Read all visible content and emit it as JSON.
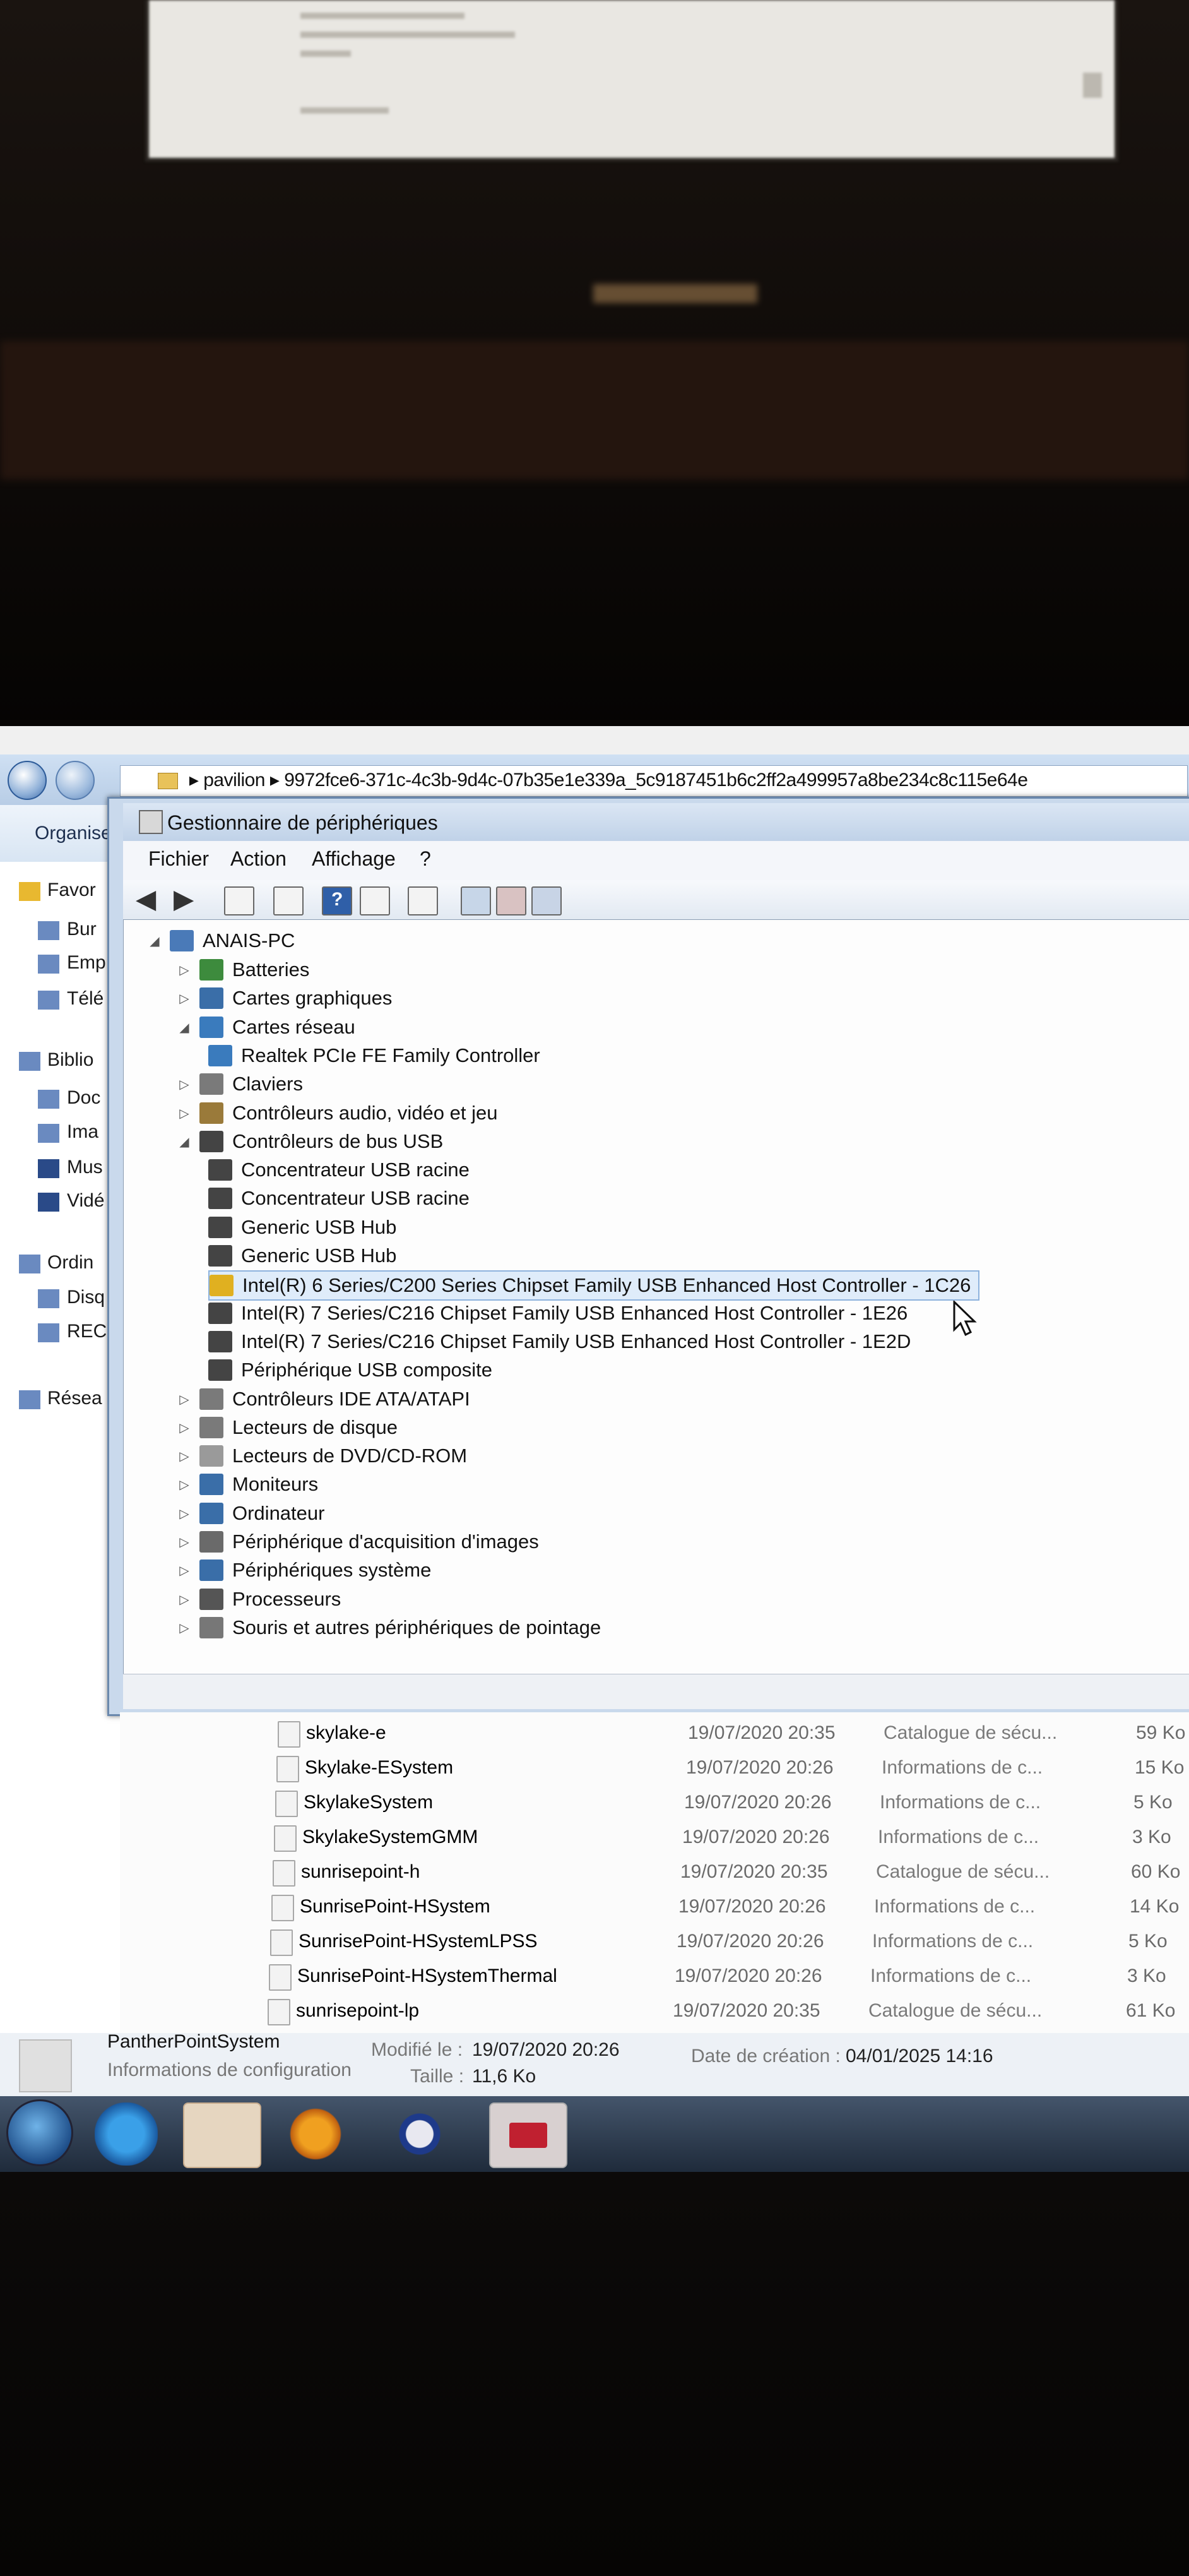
{
  "explorer": {
    "address_prefix": "pavilion",
    "address_path": "9972fce6-371c-4c3b-9d4c-07b35e1e339a_5c9187451b6c2ff2a499957a8be234c8c115e64e",
    "organise_label": "Organiser",
    "nav_items": [
      "Favor",
      "Bur",
      "Emp",
      "Télé",
      "Biblio",
      "Doc",
      "Ima",
      "Mus",
      "Vidé",
      "Ordin",
      "Disq",
      "REC",
      "Résea"
    ],
    "files": [
      {
        "name": "skylake-e",
        "date": "19/07/2020 20:35",
        "type": "Catalogue de sécu...",
        "size": "59 Ko"
      },
      {
        "name": "Skylake-ESystem",
        "date": "19/07/2020 20:26",
        "type": "Informations de c...",
        "size": "15 Ko"
      },
      {
        "name": "SkylakeSystem",
        "date": "19/07/2020 20:26",
        "type": "Informations de c...",
        "size": "5 Ko"
      },
      {
        "name": "SkylakeSystemGMM",
        "date": "19/07/2020 20:26",
        "type": "Informations de c...",
        "size": "3 Ko"
      },
      {
        "name": "sunrisepoint-h",
        "date": "19/07/2020 20:35",
        "type": "Catalogue de sécu...",
        "size": "60 Ko"
      },
      {
        "name": "SunrisePoint-HSystem",
        "date": "19/07/2020 20:26",
        "type": "Informations de c...",
        "size": "14 Ko"
      },
      {
        "name": "SunrisePoint-HSystemLPSS",
        "date": "19/07/2020 20:26",
        "type": "Informations de c...",
        "size": "5 Ko"
      },
      {
        "name": "SunrisePoint-HSystemThermal",
        "date": "19/07/2020 20:26",
        "type": "Informations de c...",
        "size": "3 Ko"
      },
      {
        "name": "sunrisepoint-lp",
        "date": "19/07/2020 20:35",
        "type": "Catalogue de sécu...",
        "size": "61 Ko"
      }
    ],
    "details": {
      "name": "PantherPointSystem",
      "kind": "Informations de configuration",
      "modified_label": "Modifié le :",
      "modified_value": "19/07/2020 20:26",
      "size_label": "Taille :",
      "size_value": "11,6 Ko",
      "created_label": "Date de création :",
      "created_value": "04/01/2025 14:16"
    }
  },
  "device_manager": {
    "title": "Gestionnaire de périphériques",
    "menu": [
      "Fichier",
      "Action",
      "Affichage",
      "?"
    ],
    "root": "ANAIS-PC",
    "tree": [
      {
        "label": "Batteries",
        "level": 1,
        "expander": "closed",
        "icon": "battery-icon",
        "color": "#3d8b3d"
      },
      {
        "label": "Cartes graphiques",
        "level": 1,
        "expander": "closed",
        "icon": "display-adapter-icon",
        "color": "#3a6ea8"
      },
      {
        "label": "Cartes réseau",
        "level": 1,
        "expander": "open",
        "icon": "network-adapter-icon",
        "color": "#3a7bbd"
      },
      {
        "label": "Realtek PCIe FE Family Controller",
        "level": 2,
        "expander": "none",
        "icon": "network-card-icon",
        "color": "#3a7bbd"
      },
      {
        "label": "Claviers",
        "level": 1,
        "expander": "closed",
        "icon": "keyboard-icon",
        "color": "#7a7a7a"
      },
      {
        "label": "Contrôleurs audio, vidéo et jeu",
        "level": 1,
        "expander": "closed",
        "icon": "audio-icon",
        "color": "#9a7a3a"
      },
      {
        "label": "Contrôleurs de bus USB",
        "level": 1,
        "expander": "open",
        "icon": "usb-icon",
        "color": "#444444"
      },
      {
        "label": "Concentrateur USB racine",
        "level": 2,
        "expander": "none",
        "icon": "usb-icon",
        "color": "#444444"
      },
      {
        "label": "Concentrateur USB racine",
        "level": 2,
        "expander": "none",
        "icon": "usb-icon",
        "color": "#444444"
      },
      {
        "label": "Generic USB Hub",
        "level": 2,
        "expander": "none",
        "icon": "usb-icon",
        "color": "#444444"
      },
      {
        "label": "Generic USB Hub",
        "level": 2,
        "expander": "none",
        "icon": "usb-icon",
        "color": "#444444"
      },
      {
        "label": "Intel(R) 6 Series/C200 Series Chipset Family USB Enhanced Host Controller - 1C26",
        "level": 2,
        "expander": "none",
        "icon": "usb-warning-icon",
        "color": "#e0b020",
        "selected": true
      },
      {
        "label": "Intel(R) 7 Series/C216 Chipset Family USB Enhanced Host Controller - 1E26",
        "level": 2,
        "expander": "none",
        "icon": "usb-icon",
        "color": "#444444"
      },
      {
        "label": "Intel(R) 7 Series/C216 Chipset Family USB Enhanced Host Controller - 1E2D",
        "level": 2,
        "expander": "none",
        "icon": "usb-icon",
        "color": "#444444"
      },
      {
        "label": "Périphérique USB composite",
        "level": 2,
        "expander": "none",
        "icon": "usb-icon",
        "color": "#444444"
      },
      {
        "label": "Contrôleurs IDE ATA/ATAPI",
        "level": 1,
        "expander": "closed",
        "icon": "ide-controller-icon",
        "color": "#7a7a7a"
      },
      {
        "label": "Lecteurs de disque",
        "level": 1,
        "expander": "closed",
        "icon": "disk-drive-icon",
        "color": "#7a7a7a"
      },
      {
        "label": "Lecteurs de DVD/CD-ROM",
        "level": 1,
        "expander": "closed",
        "icon": "dvd-drive-icon",
        "color": "#9a9a9a"
      },
      {
        "label": "Moniteurs",
        "level": 1,
        "expander": "closed",
        "icon": "monitor-icon",
        "color": "#3a6ea8"
      },
      {
        "label": "Ordinateur",
        "level": 1,
        "expander": "closed",
        "icon": "computer-icon",
        "color": "#3a6ea8"
      },
      {
        "label": "Périphérique d'acquisition d'images",
        "level": 1,
        "expander": "closed",
        "icon": "camera-icon",
        "color": "#6a6a6a"
      },
      {
        "label": "Périphériques système",
        "level": 1,
        "expander": "closed",
        "icon": "system-device-icon",
        "color": "#3a6ea8"
      },
      {
        "label": "Processeurs",
        "level": 1,
        "expander": "closed",
        "icon": "processor-icon",
        "color": "#555555"
      },
      {
        "label": "Souris et autres périphériques de pointage",
        "level": 1,
        "expander": "closed",
        "icon": "mouse-icon",
        "color": "#777777"
      }
    ]
  },
  "taskbar": {
    "items": [
      "start-orb-icon",
      "internet-explorer-icon",
      "explorer-icon",
      "media-player-icon",
      "hp-icon",
      "toolbox-icon"
    ]
  }
}
